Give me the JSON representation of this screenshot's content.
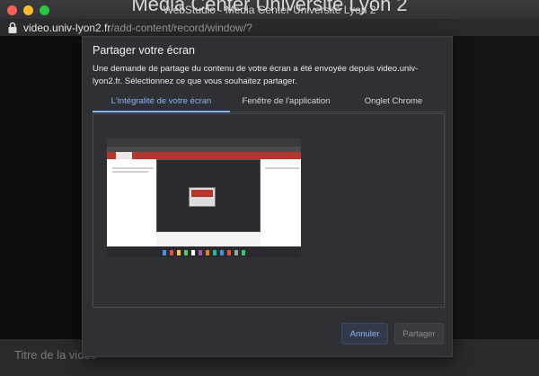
{
  "background_title": "Media Center Université Lyon 2",
  "window": {
    "title": "WebStudio - Media Center Université Lyon 2"
  },
  "address_bar": {
    "domain": "video.univ-lyon2.fr",
    "path": "/add-content/record/window/?"
  },
  "page": {
    "video_title_label": "Titre de la vidéo"
  },
  "dialog": {
    "title": "Partager votre écran",
    "description": "Une demande de partage du contenu de votre écran a été envoyée depuis video.univ-lyon2.fr. Sélectionnez ce que vous souhaitez partager.",
    "tabs": [
      {
        "label": "L'intégralité de votre écran",
        "selected": true
      },
      {
        "label": "Fenêtre de l'application",
        "selected": false
      },
      {
        "label": "Onglet Chrome",
        "selected": false
      }
    ],
    "buttons": {
      "cancel": "Annuler",
      "share": "Partager"
    }
  },
  "colors": {
    "accent": "#8ab4f8",
    "dialog_bg": "#2f3033",
    "brand_red": "#b3372f"
  }
}
